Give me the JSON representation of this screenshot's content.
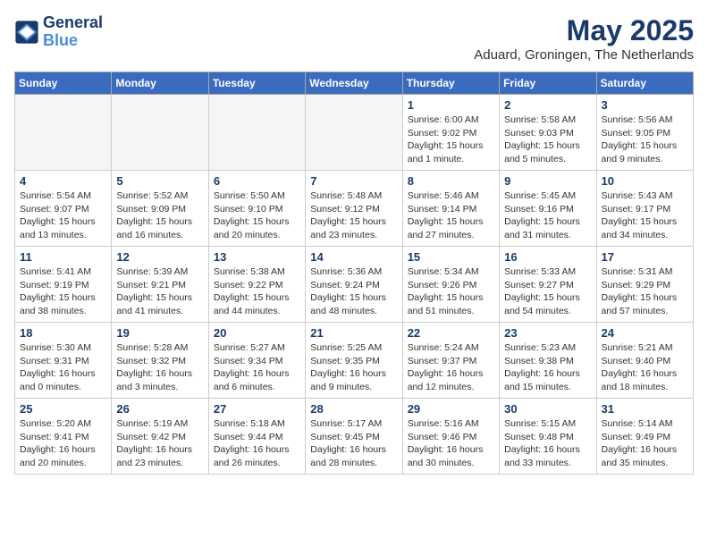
{
  "header": {
    "logo_line1": "General",
    "logo_line2": "Blue",
    "month": "May 2025",
    "location": "Aduard, Groningen, The Netherlands"
  },
  "days_of_week": [
    "Sunday",
    "Monday",
    "Tuesday",
    "Wednesday",
    "Thursday",
    "Friday",
    "Saturday"
  ],
  "weeks": [
    [
      {
        "day": "",
        "empty": true
      },
      {
        "day": "",
        "empty": true
      },
      {
        "day": "",
        "empty": true
      },
      {
        "day": "",
        "empty": true
      },
      {
        "day": "1",
        "sunrise": "6:00 AM",
        "sunset": "9:02 PM",
        "daylight": "15 hours and 1 minute."
      },
      {
        "day": "2",
        "sunrise": "5:58 AM",
        "sunset": "9:03 PM",
        "daylight": "15 hours and 5 minutes."
      },
      {
        "day": "3",
        "sunrise": "5:56 AM",
        "sunset": "9:05 PM",
        "daylight": "15 hours and 9 minutes."
      }
    ],
    [
      {
        "day": "4",
        "sunrise": "5:54 AM",
        "sunset": "9:07 PM",
        "daylight": "15 hours and 13 minutes."
      },
      {
        "day": "5",
        "sunrise": "5:52 AM",
        "sunset": "9:09 PM",
        "daylight": "15 hours and 16 minutes."
      },
      {
        "day": "6",
        "sunrise": "5:50 AM",
        "sunset": "9:10 PM",
        "daylight": "15 hours and 20 minutes."
      },
      {
        "day": "7",
        "sunrise": "5:48 AM",
        "sunset": "9:12 PM",
        "daylight": "15 hours and 23 minutes."
      },
      {
        "day": "8",
        "sunrise": "5:46 AM",
        "sunset": "9:14 PM",
        "daylight": "15 hours and 27 minutes."
      },
      {
        "day": "9",
        "sunrise": "5:45 AM",
        "sunset": "9:16 PM",
        "daylight": "15 hours and 31 minutes."
      },
      {
        "day": "10",
        "sunrise": "5:43 AM",
        "sunset": "9:17 PM",
        "daylight": "15 hours and 34 minutes."
      }
    ],
    [
      {
        "day": "11",
        "sunrise": "5:41 AM",
        "sunset": "9:19 PM",
        "daylight": "15 hours and 38 minutes."
      },
      {
        "day": "12",
        "sunrise": "5:39 AM",
        "sunset": "9:21 PM",
        "daylight": "15 hours and 41 minutes."
      },
      {
        "day": "13",
        "sunrise": "5:38 AM",
        "sunset": "9:22 PM",
        "daylight": "15 hours and 44 minutes."
      },
      {
        "day": "14",
        "sunrise": "5:36 AM",
        "sunset": "9:24 PM",
        "daylight": "15 hours and 48 minutes."
      },
      {
        "day": "15",
        "sunrise": "5:34 AM",
        "sunset": "9:26 PM",
        "daylight": "15 hours and 51 minutes."
      },
      {
        "day": "16",
        "sunrise": "5:33 AM",
        "sunset": "9:27 PM",
        "daylight": "15 hours and 54 minutes."
      },
      {
        "day": "17",
        "sunrise": "5:31 AM",
        "sunset": "9:29 PM",
        "daylight": "15 hours and 57 minutes."
      }
    ],
    [
      {
        "day": "18",
        "sunrise": "5:30 AM",
        "sunset": "9:31 PM",
        "daylight": "16 hours and 0 minutes."
      },
      {
        "day": "19",
        "sunrise": "5:28 AM",
        "sunset": "9:32 PM",
        "daylight": "16 hours and 3 minutes."
      },
      {
        "day": "20",
        "sunrise": "5:27 AM",
        "sunset": "9:34 PM",
        "daylight": "16 hours and 6 minutes."
      },
      {
        "day": "21",
        "sunrise": "5:25 AM",
        "sunset": "9:35 PM",
        "daylight": "16 hours and 9 minutes."
      },
      {
        "day": "22",
        "sunrise": "5:24 AM",
        "sunset": "9:37 PM",
        "daylight": "16 hours and 12 minutes."
      },
      {
        "day": "23",
        "sunrise": "5:23 AM",
        "sunset": "9:38 PM",
        "daylight": "16 hours and 15 minutes."
      },
      {
        "day": "24",
        "sunrise": "5:21 AM",
        "sunset": "9:40 PM",
        "daylight": "16 hours and 18 minutes."
      }
    ],
    [
      {
        "day": "25",
        "sunrise": "5:20 AM",
        "sunset": "9:41 PM",
        "daylight": "16 hours and 20 minutes."
      },
      {
        "day": "26",
        "sunrise": "5:19 AM",
        "sunset": "9:42 PM",
        "daylight": "16 hours and 23 minutes."
      },
      {
        "day": "27",
        "sunrise": "5:18 AM",
        "sunset": "9:44 PM",
        "daylight": "16 hours and 26 minutes."
      },
      {
        "day": "28",
        "sunrise": "5:17 AM",
        "sunset": "9:45 PM",
        "daylight": "16 hours and 28 minutes."
      },
      {
        "day": "29",
        "sunrise": "5:16 AM",
        "sunset": "9:46 PM",
        "daylight": "16 hours and 30 minutes."
      },
      {
        "day": "30",
        "sunrise": "5:15 AM",
        "sunset": "9:48 PM",
        "daylight": "16 hours and 33 minutes."
      },
      {
        "day": "31",
        "sunrise": "5:14 AM",
        "sunset": "9:49 PM",
        "daylight": "16 hours and 35 minutes."
      }
    ]
  ]
}
